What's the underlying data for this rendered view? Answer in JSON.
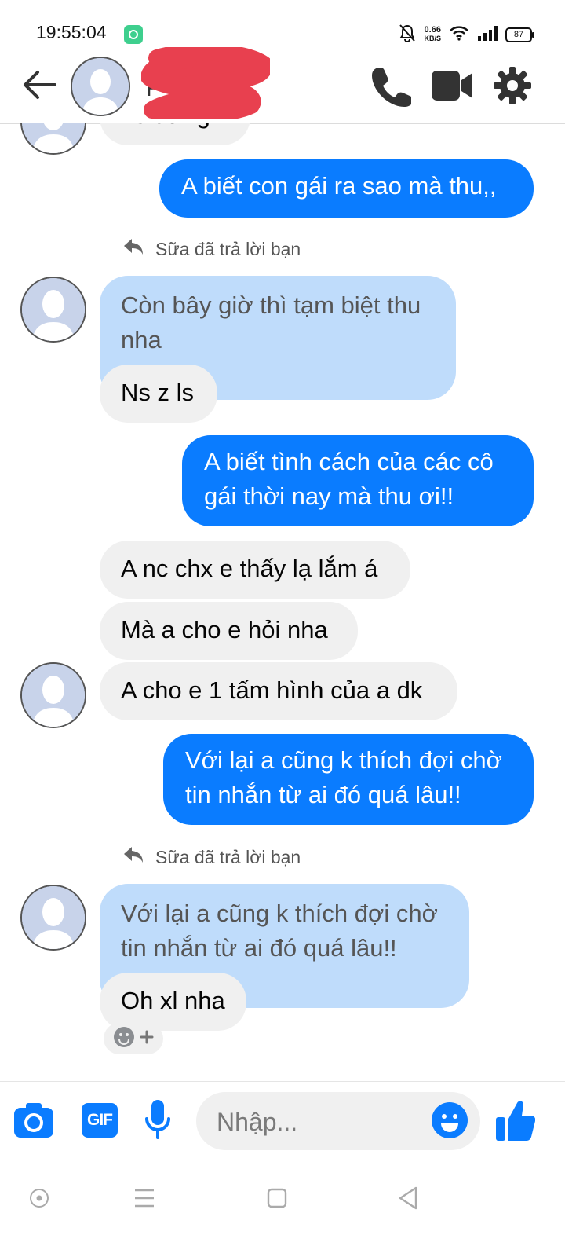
{
  "status_bar": {
    "time": "19:55:04",
    "net_speed_value": "0.66",
    "net_speed_unit": "KB/S",
    "battery": "87"
  },
  "header": {
    "contact_name": "F"
  },
  "messages": [
    {
      "side": "in",
      "text": "Ls dừng"
    },
    {
      "side": "out",
      "text": "A biết con gái ra sao mà thu,,"
    },
    {
      "side": "reply_label",
      "text": "Sữa đã trả lời bạn"
    },
    {
      "side": "quoted",
      "text": "Còn bây giờ thì tạm biệt thu nha"
    },
    {
      "side": "in",
      "text": "Ns z ls"
    },
    {
      "side": "out",
      "text": "A biết tình cách của các cô gái  thời nay mà thu ơi!!"
    },
    {
      "side": "in",
      "text": "A nc chx e thấy lạ lắm á"
    },
    {
      "side": "in",
      "text": "Mà a cho e hỏi nha"
    },
    {
      "side": "in",
      "text": "A cho e 1 tấm hình của a dk"
    },
    {
      "side": "out",
      "text": "Với lại a cũng k thích đợi chờ tin nhắn từ ai đó quá lâu!!"
    },
    {
      "side": "reply_label",
      "text": "Sữa đã trả lời bạn"
    },
    {
      "side": "quoted",
      "text": "Với lại a cũng k thích đợi chờ tin nhắn từ ai đó quá lâu!!"
    },
    {
      "side": "in",
      "text": "Oh xl nha"
    }
  ],
  "composer": {
    "placeholder": "Nhập...",
    "gif_label": "GIF"
  },
  "colors": {
    "accent": "#0a7cff",
    "incoming_bubble": "#f0f0f0",
    "quoted_bubble": "#bfdcfb",
    "redaction": "#e8404f"
  },
  "icons": [
    "back-arrow-icon",
    "phone-icon",
    "video-camera-icon",
    "gear-icon",
    "reply-icon",
    "camera-icon",
    "gif-icon",
    "microphone-icon",
    "emoji-icon",
    "thumbs-up-icon",
    "home-circle-icon",
    "menu-icon",
    "square-icon",
    "back-triangle-icon"
  ]
}
